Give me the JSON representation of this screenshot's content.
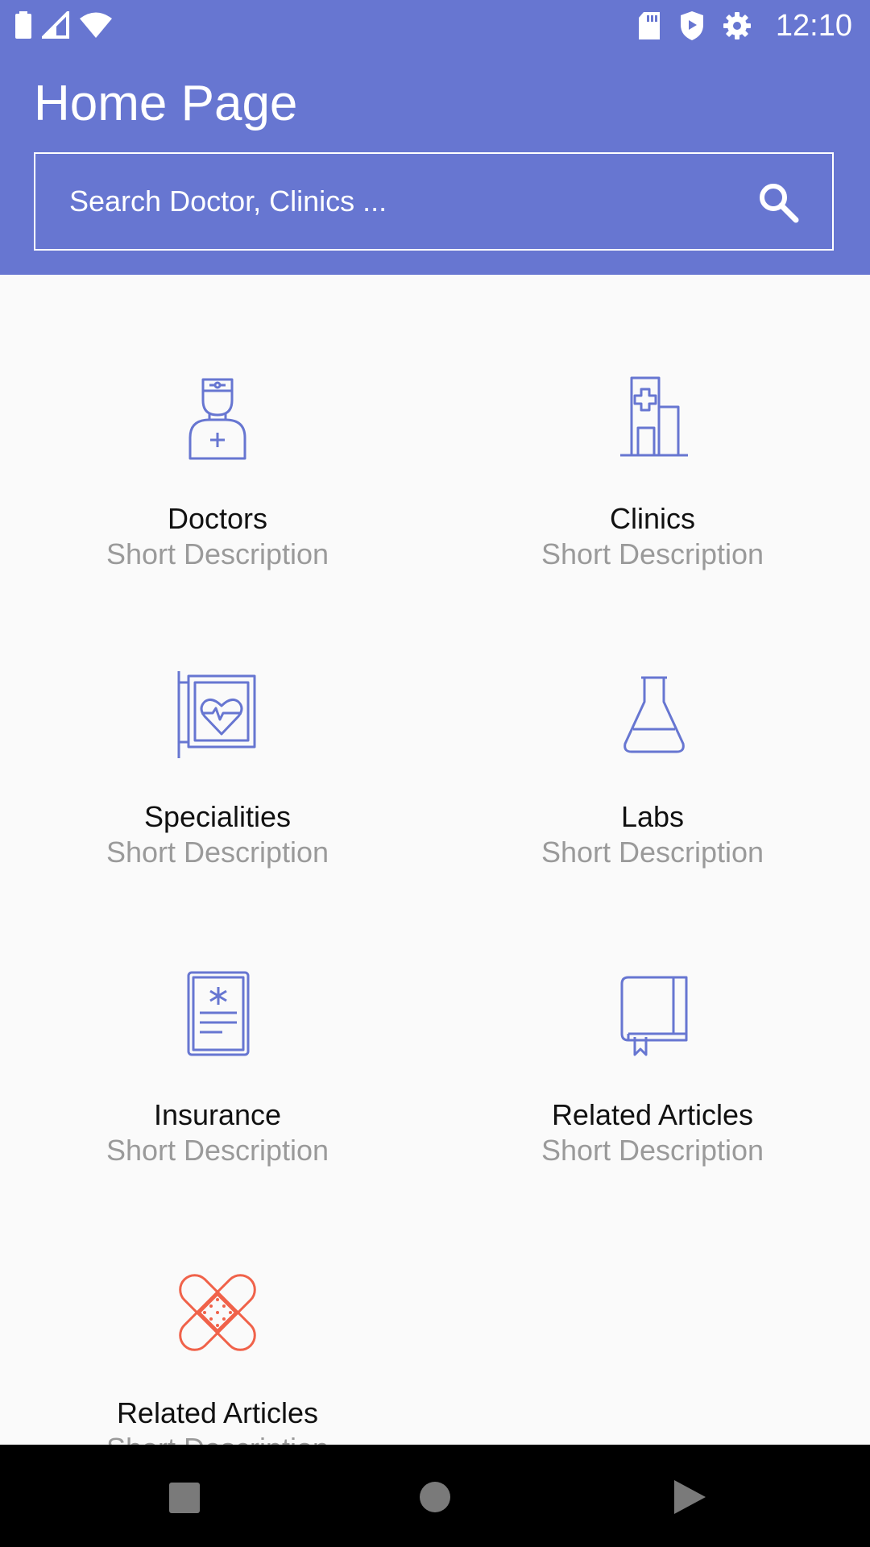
{
  "status_bar": {
    "time": "12:10",
    "left_icons": [
      "battery-icon",
      "signal-icon",
      "wifi-icon"
    ],
    "right_icons": [
      "sd-card-icon",
      "shield-icon",
      "settings-icon"
    ]
  },
  "header": {
    "title": "Home Page",
    "background_color": "#6776d1"
  },
  "search": {
    "placeholder": "Search Doctor, Clinics ...",
    "value": "",
    "icon": "search-icon"
  },
  "categories": [
    {
      "id": "doctors",
      "title": "Doctors",
      "description": "Short Description",
      "icon": "doctor-icon",
      "color": "#6776d1"
    },
    {
      "id": "clinics",
      "title": "Clinics",
      "description": "Short Description",
      "icon": "hospital-building-icon",
      "color": "#6776d1"
    },
    {
      "id": "specialities",
      "title": "Specialities",
      "description": "Short Description",
      "icon": "heart-sign-icon",
      "color": "#6776d1"
    },
    {
      "id": "labs",
      "title": "Labs",
      "description": "Short Description",
      "icon": "flask-icon",
      "color": "#6776d1"
    },
    {
      "id": "insurance",
      "title": "Insurance",
      "description": "Short Description",
      "icon": "medical-document-icon",
      "color": "#6776d1"
    },
    {
      "id": "related-articles-1",
      "title": "Related Articles",
      "description": "Short Description",
      "icon": "book-icon",
      "color": "#6776d1"
    },
    {
      "id": "related-articles-2",
      "title": "Related Articles",
      "description": "Short Description",
      "icon": "bandage-icon",
      "color": "#f0624a"
    }
  ],
  "nav_bar": {
    "buttons": [
      "recents-button",
      "home-button",
      "back-button"
    ]
  }
}
